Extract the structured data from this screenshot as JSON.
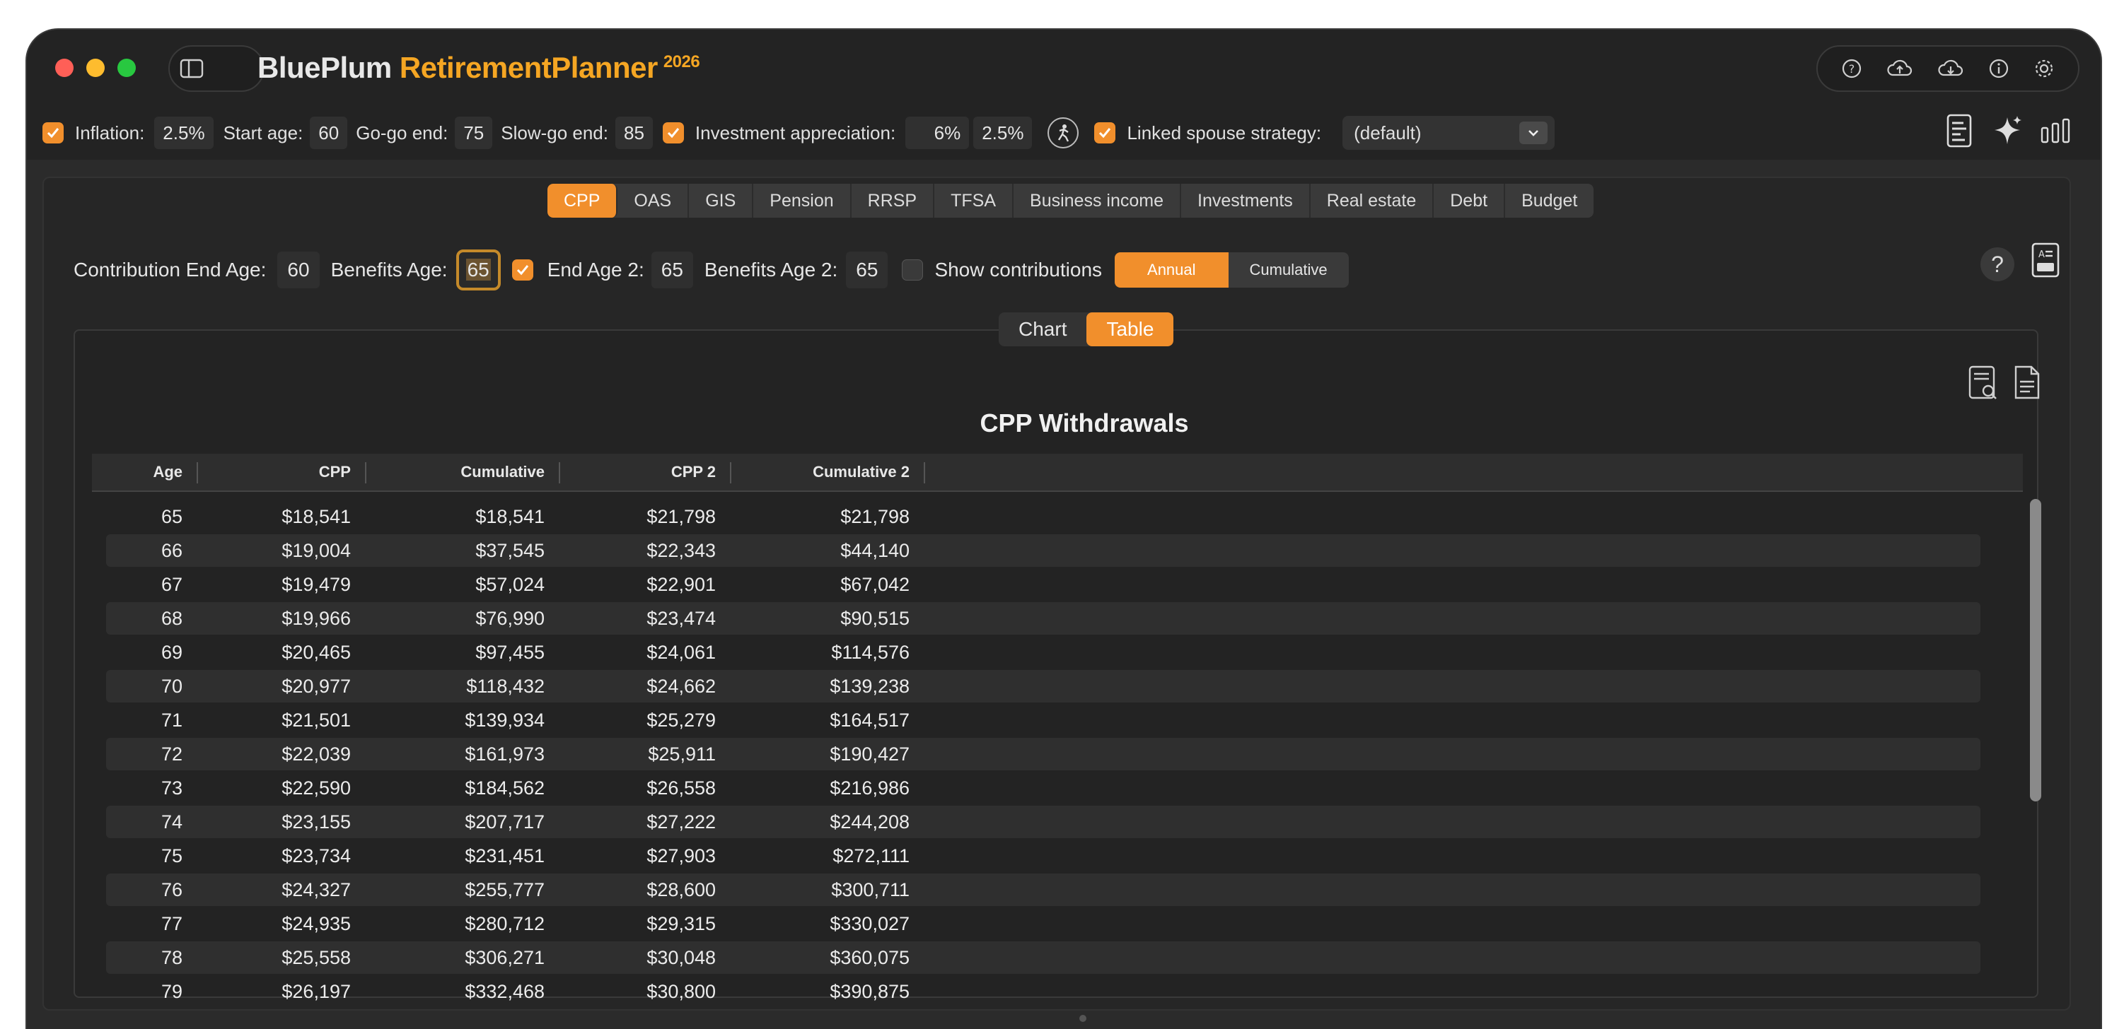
{
  "app": {
    "title_part1": "BluePlum ",
    "title_part2": "RetirementPlanner",
    "year": "2026"
  },
  "toolbar": {
    "inflation_label": "Inflation:",
    "inflation_value": "2.5%",
    "start_age_label": "Start age:",
    "start_age_value": "60",
    "gogo_end_label": "Go-go end:",
    "gogo_end_value": "75",
    "slowgo_end_label": "Slow-go end:",
    "slowgo_end_value": "85",
    "investment_label": "Investment appreciation:",
    "investment_value1": "6%",
    "investment_value2": "2.5%",
    "spouse_label": "Linked spouse strategy:",
    "spouse_value": "(default)"
  },
  "tabs": [
    "CPP",
    "OAS",
    "GIS",
    "Pension",
    "RRSP",
    "TFSA",
    "Business income",
    "Investments",
    "Real estate",
    "Debt",
    "Budget"
  ],
  "controls": {
    "contribution_end_label": "Contribution End Age:",
    "contribution_end_value": "60",
    "benefits_age_label": "Benefits Age:",
    "benefits_age_value": "65",
    "end_age2_label": "End Age 2:",
    "end_age2_value": "65",
    "benefits_age2_label": "Benefits Age 2:",
    "benefits_age2_value": "65",
    "show_contributions_label": "Show contributions",
    "annual_label": "Annual",
    "cumulative_label": "Cumulative",
    "help_label": "?"
  },
  "view_toggle": {
    "chart": "Chart",
    "table": "Table"
  },
  "table": {
    "title": "CPP Withdrawals",
    "columns": [
      "Age",
      "CPP",
      "Cumulative",
      "CPP 2",
      "Cumulative 2"
    ],
    "rows": [
      [
        "65",
        "$18,541",
        "$18,541",
        "$21,798",
        "$21,798"
      ],
      [
        "66",
        "$19,004",
        "$37,545",
        "$22,343",
        "$44,140"
      ],
      [
        "67",
        "$19,479",
        "$57,024",
        "$22,901",
        "$67,042"
      ],
      [
        "68",
        "$19,966",
        "$76,990",
        "$23,474",
        "$90,515"
      ],
      [
        "69",
        "$20,465",
        "$97,455",
        "$24,061",
        "$114,576"
      ],
      [
        "70",
        "$20,977",
        "$118,432",
        "$24,662",
        "$139,238"
      ],
      [
        "71",
        "$21,501",
        "$139,934",
        "$25,279",
        "$164,517"
      ],
      [
        "72",
        "$22,039",
        "$161,973",
        "$25,911",
        "$190,427"
      ],
      [
        "73",
        "$22,590",
        "$184,562",
        "$26,558",
        "$216,986"
      ],
      [
        "74",
        "$23,155",
        "$207,717",
        "$27,222",
        "$244,208"
      ],
      [
        "75",
        "$23,734",
        "$231,451",
        "$27,903",
        "$272,111"
      ],
      [
        "76",
        "$24,327",
        "$255,777",
        "$28,600",
        "$300,711"
      ],
      [
        "77",
        "$24,935",
        "$280,712",
        "$29,315",
        "$330,027"
      ],
      [
        "78",
        "$25,558",
        "$306,271",
        "$30,048",
        "$360,075"
      ],
      [
        "79",
        "$26,197",
        "$332,468",
        "$30,800",
        "$390,875"
      ]
    ]
  },
  "colors": {
    "accent": "#f18f2c",
    "background": "#2b2b2b",
    "title_accent": "#f5a623"
  }
}
